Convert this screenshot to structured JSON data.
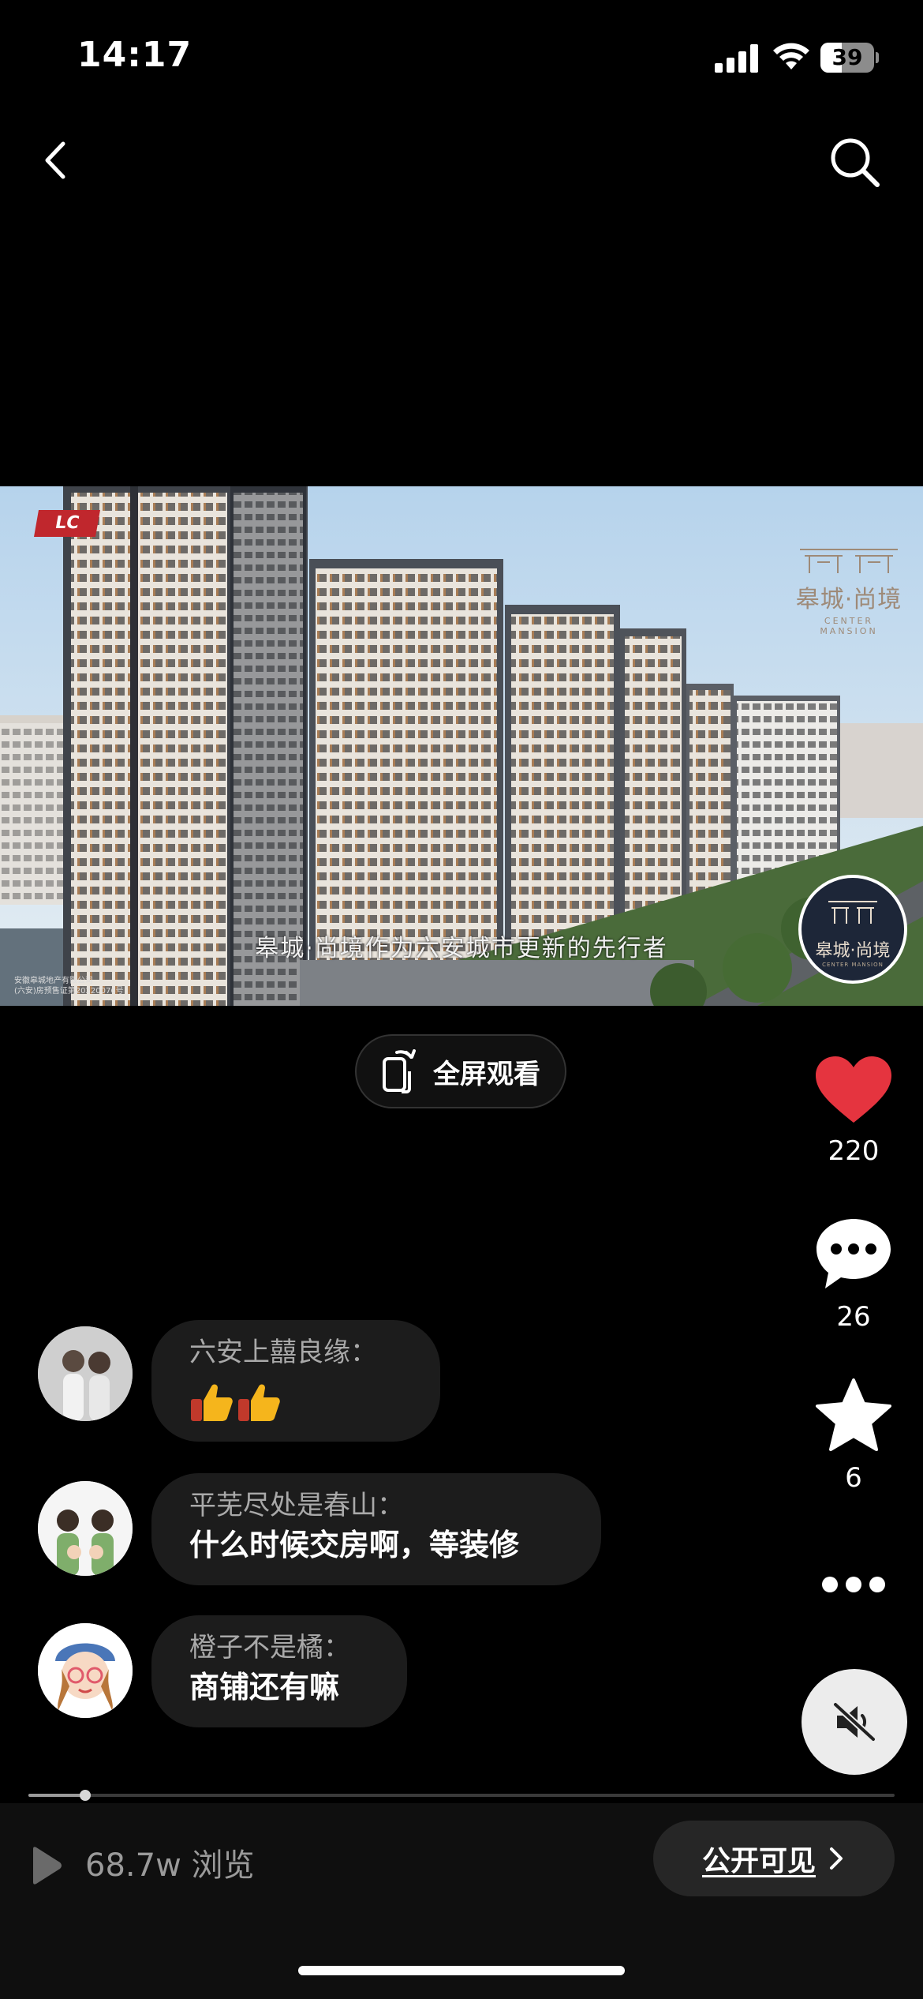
{
  "status_bar": {
    "time": "14:17",
    "battery": "39",
    "battery_level": 0.39
  },
  "nav": {
    "back": "back-icon",
    "search": "search-icon"
  },
  "video": {
    "subtitle": "皋城·尚境作为六安城市更新的先行者",
    "brand_top": "皋城·尚境",
    "brand_top_en": "CENTER MANSION",
    "brand_badge": "皋城·尚境",
    "brand_badge_en": "CENTER MANSION",
    "logo_text": "LC",
    "legal_line1": "安徽皋城地产有限公司",
    "legal_line2": "(六安)房预售证第20220076号"
  },
  "fullscreen": {
    "label": "全屏观看"
  },
  "actions": {
    "likes": "220",
    "comments": "26",
    "favorites": "6"
  },
  "comments": [
    {
      "name": "六安上囍良缘：",
      "text": ""
    },
    {
      "name": "平芜尽处是春山：",
      "text": "什么时候交房啊，等装修"
    },
    {
      "name": "橙子不是橘：",
      "text": "商铺还有嘛"
    }
  ],
  "progress": {
    "played_fraction": 0.066
  },
  "bottom": {
    "views": "68.7w 浏览",
    "visibility": "公开可见"
  },
  "colors": {
    "like": "#e5343f",
    "background": "#000000",
    "bubble": "#1c1c1c"
  }
}
